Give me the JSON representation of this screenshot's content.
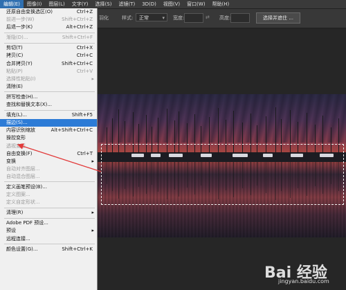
{
  "menubar": {
    "items": [
      "编辑(E)",
      "图像(I)",
      "图层(L)",
      "文字(Y)",
      "选择(S)",
      "滤镜(T)",
      "3D(D)",
      "视图(V)",
      "窗口(W)",
      "帮助(H)"
    ],
    "active_index": 0
  },
  "options_bar": {
    "feather_label": "羽化",
    "style_label": "样式:",
    "style_value": "正常",
    "width_label": "宽度:",
    "height_label": "高度:",
    "swap_icon": "swap-arrows-icon",
    "select_mask_button": "选择并遮住 ..."
  },
  "edit_menu": {
    "groups": [
      [
        {
          "label": "还原自由变换选区(O)",
          "shortcut": "Ctrl+Z"
        },
        {
          "label": "前进一步(W)",
          "shortcut": "Shift+Ctrl+Z",
          "disabled": true
        },
        {
          "label": "后退一步(K)",
          "shortcut": "Alt+Ctrl+Z"
        }
      ],
      [
        {
          "label": "渐隐(D)...",
          "shortcut": "Shift+Ctrl+F",
          "disabled": true
        }
      ],
      [
        {
          "label": "剪切(T)",
          "shortcut": "Ctrl+X"
        },
        {
          "label": "拷贝(C)",
          "shortcut": "Ctrl+C"
        },
        {
          "label": "合并拷贝(Y)",
          "shortcut": "Shift+Ctrl+C"
        },
        {
          "label": "粘贴(P)",
          "shortcut": "Ctrl+V",
          "disabled": true
        },
        {
          "label": "选择性粘贴(I)",
          "submenu": true,
          "disabled": true
        },
        {
          "label": "清除(E)"
        }
      ],
      [
        {
          "label": "拼写检查(H)..."
        },
        {
          "label": "查找和替换文本(X)..."
        }
      ],
      [
        {
          "label": "填充(L)...",
          "shortcut": "Shift+F5"
        },
        {
          "label": "描边(S)...",
          "highlighted": true
        },
        {
          "label": "内容识别缩放",
          "shortcut": "Alt+Shift+Ctrl+C"
        },
        {
          "label": "操控变形"
        },
        {
          "label": "透视变形",
          "disabled": true
        },
        {
          "label": "自由变换(F)",
          "shortcut": "Ctrl+T"
        },
        {
          "label": "变换",
          "submenu": true
        },
        {
          "label": "自动对齐图层...",
          "disabled": true
        },
        {
          "label": "自动混合图层...",
          "disabled": true
        }
      ],
      [
        {
          "label": "定义画笔预设(B)..."
        },
        {
          "label": "定义图案...",
          "disabled": true
        },
        {
          "label": "定义自定形状...",
          "disabled": true
        }
      ],
      [
        {
          "label": "清理(R)",
          "submenu": true
        }
      ],
      [
        {
          "label": "Adobe PDF 预设..."
        },
        {
          "label": "预设",
          "submenu": true
        },
        {
          "label": "远程连接..."
        }
      ],
      [
        {
          "label": "颜色设置(G)...",
          "shortcut": "Shift+Ctrl+K"
        }
      ]
    ]
  },
  "annotation": {
    "arrow_color": "#e23a3a"
  },
  "watermark": {
    "text": "Bai 经验",
    "url": "jingyan.baidu.com"
  },
  "colors": {
    "highlight": "#2c7bd6",
    "menu_bg": "#f0f0f0",
    "app_bg": "#282828"
  }
}
